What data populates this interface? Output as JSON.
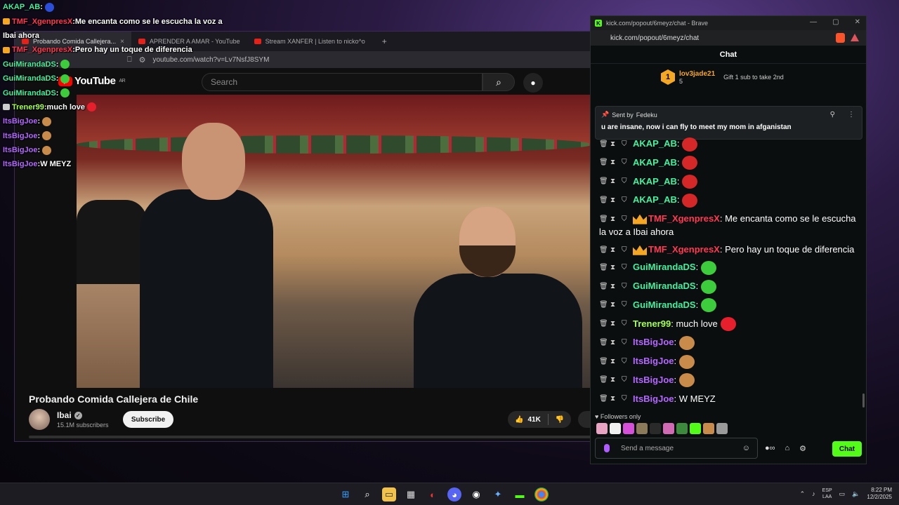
{
  "overlay": [
    {
      "user": "AKAP_AB",
      "sep": " :",
      "text": "",
      "color": "#41f2a0",
      "badge": "",
      "emote": "#2b4fd8"
    },
    {
      "user": "TMF_XgenpresX",
      "sep": " :",
      "text": " Me encanta como se le escucha la voz a",
      "color": "#ff3a52",
      "badge": "#f5a623",
      "emote": ""
    },
    {
      "user": "",
      "sep": "",
      "text": "Ibai ahora",
      "color": "#ffffff",
      "badge": "",
      "emote": ""
    },
    {
      "user": "TMF_XgenpresX",
      "sep": " :",
      "text": " Pero hay un toque de diferencia",
      "color": "#ff3a52",
      "badge": "#f5a623",
      "emote": ""
    },
    {
      "user": "GuiMirandaDS",
      "sep": " :",
      "text": "",
      "color": "#41f2a0",
      "badge": "",
      "emote": "#3ccc3c"
    },
    {
      "user": "GuiMirandaDS",
      "sep": " :",
      "text": "",
      "color": "#41f2a0",
      "badge": "",
      "emote": "#3ccc3c"
    },
    {
      "user": "GuiMirandaDS",
      "sep": " :",
      "text": "",
      "color": "#41f2a0",
      "badge": "",
      "emote": "#3ccc3c"
    },
    {
      "user": "Trener99",
      "sep": " :",
      "text": " much love",
      "color": "#a6ff4d",
      "badge": "#cccccc",
      "emote": "#e5202c"
    },
    {
      "user": "ItsBigJoe",
      "sep": " :",
      "text": "",
      "color": "#b467ff",
      "badge": "",
      "emote": "#c88b4a"
    },
    {
      "user": "ItsBigJoe",
      "sep": " :",
      "text": "",
      "color": "#b467ff",
      "badge": "",
      "emote": "#c88b4a"
    },
    {
      "user": "ItsBigJoe",
      "sep": " :",
      "text": "",
      "color": "#b467ff",
      "badge": "",
      "emote": "#c88b4a"
    },
    {
      "user": "ItsBigJoe",
      "sep": " :",
      "text": " W MEYZ",
      "color": "#b467ff",
      "badge": "",
      "emote": ""
    }
  ],
  "youtube": {
    "tabs": [
      {
        "label": "Probando Comida Callejera...",
        "active": true
      },
      {
        "label": "APRENDER A AMAR - YouTube",
        "active": false
      },
      {
        "label": "Stream XANFER | Listen to nicko^o",
        "active": false
      }
    ],
    "url": "youtube.com/watch?v=Lv7NsfJ8SYM",
    "logo": "YouTube",
    "logo_region": "AR",
    "search_placeholder": "Search",
    "video_title": "Probando Comida Callejera de Chile",
    "channel": "Ibai",
    "subscribers": "15.1M subscribers",
    "subscribe_label": "Subscribe",
    "likes": "41K"
  },
  "kick": {
    "window_title": "kick.com/popout/6meyz/chat - Brave",
    "url": "kick.com/popout/6meyz/chat",
    "header": "Chat",
    "gift": {
      "rank": "1",
      "user": "lov3jade21",
      "count": "5",
      "text": "Gift 1 sub to take 2nd"
    },
    "pinned": {
      "sent_by": "Sent by",
      "user": "Fedeku",
      "text": "u are insane, now i can fly to meet my mom in afganistan"
    },
    "messages": [
      {
        "user": "AKAP_AB",
        "sep": ":",
        "text": "",
        "color": "#41f2a0",
        "crown": false,
        "emote": "#d42727"
      },
      {
        "user": "AKAP_AB",
        "sep": ":",
        "text": "",
        "color": "#41f2a0",
        "crown": false,
        "emote": "#d42727"
      },
      {
        "user": "AKAP_AB",
        "sep": ":",
        "text": "",
        "color": "#41f2a0",
        "crown": false,
        "emote": "#d42727"
      },
      {
        "user": "AKAP_AB",
        "sep": ":",
        "text": "",
        "color": "#41f2a0",
        "crown": false,
        "emote": "#d42727"
      },
      {
        "user": "TMF_XgenpresX",
        "sep": ":",
        "text": " Me encanta como se le escucha la voz a Ibai ahora",
        "color": "#ff3a52",
        "crown": true,
        "emote": ""
      },
      {
        "user": "TMF_XgenpresX",
        "sep": ":",
        "text": " Pero hay un toque de diferencia",
        "color": "#ff3a52",
        "crown": true,
        "emote": ""
      },
      {
        "user": "GuiMirandaDS",
        "sep": ":",
        "text": "",
        "color": "#41f2a0",
        "crown": false,
        "emote": "#3ccc3c"
      },
      {
        "user": "GuiMirandaDS",
        "sep": ":",
        "text": "",
        "color": "#41f2a0",
        "crown": false,
        "emote": "#3ccc3c"
      },
      {
        "user": "GuiMirandaDS",
        "sep": ":",
        "text": "",
        "color": "#41f2a0",
        "crown": false,
        "emote": "#3ccc3c"
      },
      {
        "user": "Trener99",
        "sep": ":",
        "text": " much love",
        "color": "#a6ff4d",
        "crown": false,
        "emote": "#e5202c"
      },
      {
        "user": "ItsBigJoe",
        "sep": ":",
        "text": "",
        "color": "#b467ff",
        "crown": false,
        "emote": "#c88b4a"
      },
      {
        "user": "ItsBigJoe",
        "sep": ":",
        "text": "",
        "color": "#b467ff",
        "crown": false,
        "emote": "#c88b4a"
      },
      {
        "user": "ItsBigJoe",
        "sep": ":",
        "text": "",
        "color": "#b467ff",
        "crown": false,
        "emote": "#c88b4a"
      },
      {
        "user": "ItsBigJoe",
        "sep": ":",
        "text": " W MEYZ",
        "color": "#b467ff",
        "crown": false,
        "emote": ""
      }
    ],
    "followers_only": "Followers only",
    "input_placeholder": "Send a message",
    "send_label": "Chat",
    "accent": "#53fc18"
  },
  "taskbar": {
    "lang_top": "ESP",
    "lang_bottom": "LAA",
    "time": "8:22 PM",
    "date": "12/2/2025"
  }
}
